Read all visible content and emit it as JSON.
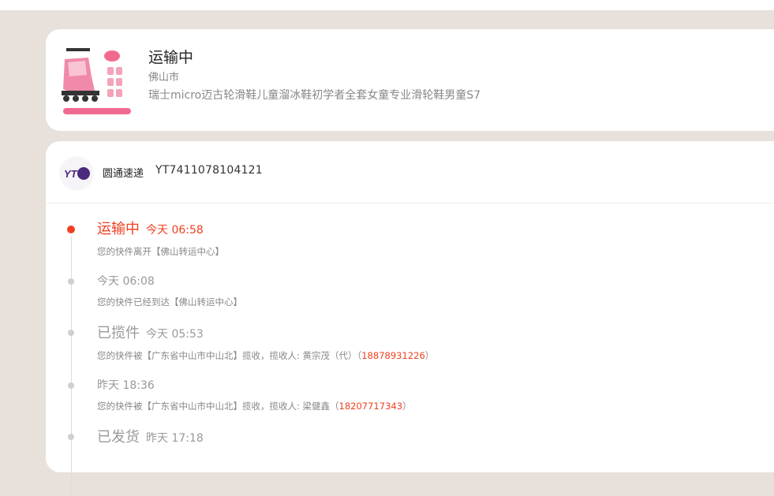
{
  "product": {
    "status": "运输中",
    "city": "佛山市",
    "name": "瑞士micro迈古轮滑鞋儿童溜冰鞋初学者全套女童专业滑轮鞋男童S7"
  },
  "carrier": {
    "logo_text": "YT",
    "name": "圆通速递",
    "tracking_number": "YT7411078104121"
  },
  "events": [
    {
      "status": "运输中",
      "time": "今天 06:58",
      "desc": "您的快件离开【佛山转运中心】",
      "phone": ""
    },
    {
      "status": "",
      "time": "今天 06:08",
      "desc": "您的快件已经到达【佛山转运中心】",
      "phone": ""
    },
    {
      "status": "已揽件",
      "time": "今天 05:53",
      "desc": "您的快件被【广东省中山市中山北】揽收，揽收人: 黄宗茂（代）（",
      "phone": "18878931226",
      "desc_suffix": "）"
    },
    {
      "status": "",
      "time": "昨天 18:36",
      "desc": "您的快件被【广东省中山市中山北】揽收，揽收人: 梁健鑫（",
      "phone": "18207717343",
      "desc_suffix": "）"
    },
    {
      "status": "已发货",
      "time": "昨天 17:18",
      "desc": "",
      "phone": ""
    }
  ],
  "colors": {
    "accent": "#f0401f",
    "background": "#e8e0db",
    "muted": "#999999"
  }
}
